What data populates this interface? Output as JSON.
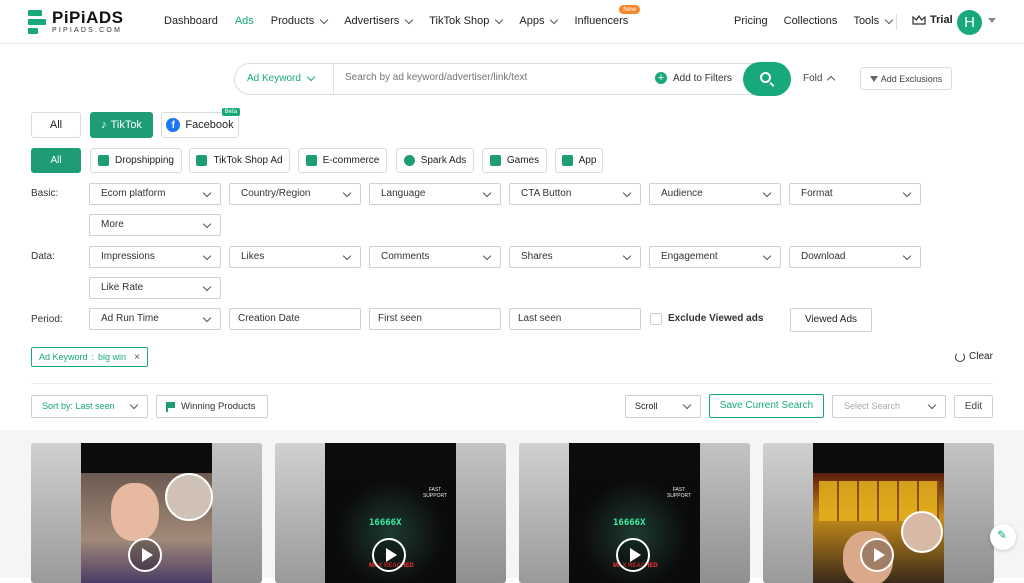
{
  "brand": {
    "name": "PiPiADS",
    "sub": "PIPIADS.COM",
    "accent": "#17a97b"
  },
  "nav": {
    "items": [
      {
        "label": "Dashboard",
        "dropdown": false
      },
      {
        "label": "Ads",
        "dropdown": false,
        "active": true
      },
      {
        "label": "Products",
        "dropdown": true
      },
      {
        "label": "Advertisers",
        "dropdown": true
      },
      {
        "label": "TikTok Shop",
        "dropdown": true
      },
      {
        "label": "Apps",
        "dropdown": true
      },
      {
        "label": "Influencers",
        "dropdown": false,
        "badge": "New"
      }
    ],
    "right": [
      {
        "label": "Pricing"
      },
      {
        "label": "Collections"
      },
      {
        "label": "Tools",
        "dropdown": true
      }
    ],
    "trial": "Trial",
    "avatar": "H"
  },
  "search": {
    "type_label": "Ad Keyword",
    "placeholder": "Search by ad keyword/advertiser/link/text",
    "add_to_filters": "Add to Filters",
    "fold": "Fold",
    "add_exclusions": "Add Exclusions"
  },
  "platforms": [
    {
      "label": "All"
    },
    {
      "label": "TikTok",
      "active": true
    },
    {
      "label": "Facebook",
      "badge": "Beta"
    }
  ],
  "categories": [
    {
      "label": "All",
      "active": true
    },
    {
      "label": "Dropshipping"
    },
    {
      "label": "TikTok Shop Ad"
    },
    {
      "label": "E-commerce"
    },
    {
      "label": "Spark Ads"
    },
    {
      "label": "Games"
    },
    {
      "label": "App"
    }
  ],
  "filters": {
    "basic_label": "Basic:",
    "basic": [
      "Ecom platform",
      "Country/Region",
      "Language",
      "CTA Button",
      "Audience",
      "Format",
      "More"
    ],
    "data_label": "Data:",
    "data": [
      "Impressions",
      "Likes",
      "Comments",
      "Shares",
      "Engagement",
      "Download",
      "Like Rate"
    ],
    "period_label": "Period:",
    "period_select": "Ad Run Time",
    "period_inputs": [
      "Creation Date",
      "First seen",
      "Last seen"
    ],
    "exclude_viewed": "Exclude Viewed ads",
    "viewed_ads": "Viewed Ads"
  },
  "active_tag": {
    "key": "Ad Keyword",
    "value": "big win",
    "close": "×"
  },
  "clear_label": "Clear",
  "toolbar": {
    "sort": "Sort by: Last seen",
    "winning": "Winning Products",
    "scroll": "Scroll",
    "save": "Save Current Search",
    "select_search": "Select Search",
    "edit": "Edit"
  },
  "cards": [
    {
      "variant": "person"
    },
    {
      "variant": "game",
      "text": "16666X",
      "label": "FAST SUPPORT",
      "maxed": "MAX REACHED"
    },
    {
      "variant": "game",
      "text": "16666X",
      "label": "FAST SUPPORT",
      "maxed": "MAX REACHED"
    },
    {
      "variant": "slot"
    }
  ]
}
